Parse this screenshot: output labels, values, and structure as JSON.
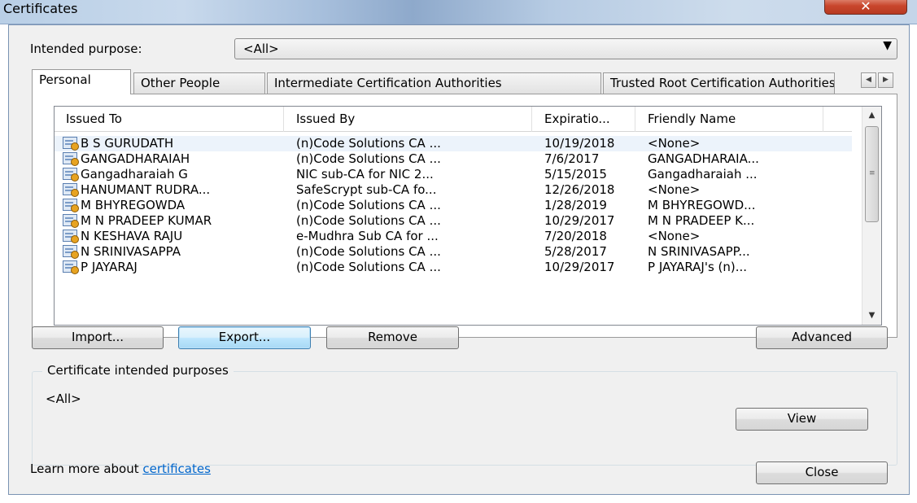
{
  "window": {
    "title": "Certificates",
    "close_glyph": "✕"
  },
  "purpose": {
    "label": "Intended purpose:",
    "value": "<All>",
    "arrow": "▼"
  },
  "tabs": [
    {
      "label": "Personal"
    },
    {
      "label": "Other People"
    },
    {
      "label": "Intermediate Certification Authorities"
    },
    {
      "label": "Trusted Root Certification Authorities"
    }
  ],
  "tab_scroll": {
    "left": "◀",
    "right": "▶"
  },
  "table": {
    "columns": [
      "Issued To",
      "Issued By",
      "Expiratio...",
      "Friendly Name"
    ],
    "rows": [
      {
        "issued_to": "B S GURUDATH",
        "issued_by": "(n)Code Solutions CA ...",
        "expiration": "10/19/2018",
        "friendly": "<None>"
      },
      {
        "issued_to": "GANGADHARAIAH",
        "issued_by": "(n)Code Solutions CA ...",
        "expiration": "7/6/2017",
        "friendly": "GANGADHARAIA..."
      },
      {
        "issued_to": "Gangadharaiah G",
        "issued_by": "NIC sub-CA for NIC 2...",
        "expiration": "5/15/2015",
        "friendly": "Gangadharaiah ..."
      },
      {
        "issued_to": "HANUMANT RUDRA...",
        "issued_by": "SafeScrypt sub-CA fo...",
        "expiration": "12/26/2018",
        "friendly": "<None>"
      },
      {
        "issued_to": "M BHYREGOWDA",
        "issued_by": "(n)Code Solutions CA ...",
        "expiration": "1/28/2019",
        "friendly": "M BHYREGOWD..."
      },
      {
        "issued_to": "M N PRADEEP KUMAR",
        "issued_by": "(n)Code Solutions CA ...",
        "expiration": "10/29/2017",
        "friendly": "M N PRADEEP K..."
      },
      {
        "issued_to": "N KESHAVA RAJU",
        "issued_by": "e-Mudhra Sub CA for ...",
        "expiration": "7/20/2018",
        "friendly": "<None>"
      },
      {
        "issued_to": "N SRINIVASAPPA",
        "issued_by": "(n)Code Solutions CA ...",
        "expiration": "5/28/2017",
        "friendly": "N SRINIVASAPP..."
      },
      {
        "issued_to": "P JAYARAJ",
        "issued_by": "(n)Code Solutions CA ...",
        "expiration": "10/29/2017",
        "friendly": "P JAYARAJ's (n)..."
      }
    ],
    "scroll": {
      "up": "▲",
      "down": "▼",
      "grip": "≡"
    }
  },
  "buttons": {
    "import": "Import...",
    "export": "Export...",
    "remove": "Remove",
    "advanced": "Advanced",
    "view": "View",
    "close": "Close"
  },
  "purposes_group": {
    "title": "Certificate intended purposes",
    "value": "<All>"
  },
  "footer": {
    "text": "Learn more about",
    "link": "certificates"
  }
}
